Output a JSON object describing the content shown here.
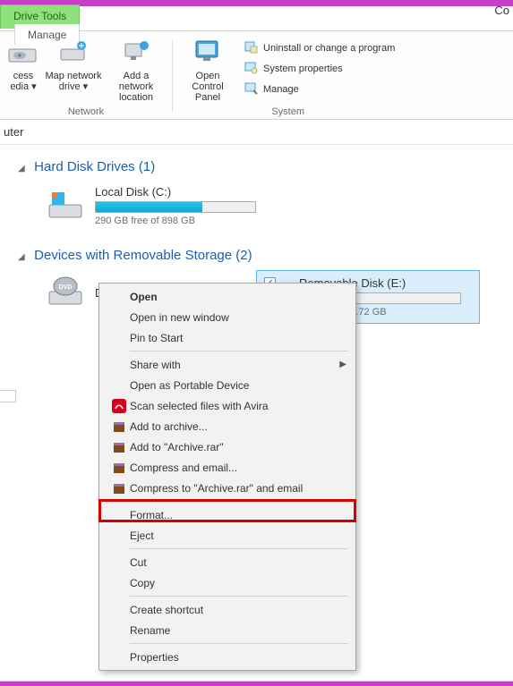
{
  "header": {
    "co": "Co"
  },
  "tabs": {
    "drive_tools": "Drive Tools",
    "manage": "Manage"
  },
  "ribbon": {
    "cess_media": "cess\nedia ▾",
    "map_network_drive": "Map network\ndrive ▾",
    "add_network_location": "Add a network\nlocation",
    "open_control_panel": "Open Control\nPanel",
    "network_group": "Network",
    "system_group": "System",
    "uninstall": "Uninstall or change a program",
    "sys_props": "System properties",
    "manage": "Manage"
  },
  "breadcrumb": "uter",
  "sections": {
    "hdd_title": "Hard Disk Drives",
    "hdd_count": "(1)",
    "dev_title": "Devices with Removable Storage",
    "dev_count": "(2)"
  },
  "drives": {
    "local": {
      "name": "Local Disk (C:)",
      "free": "290 GB free of 898 GB",
      "fill_pct": 67
    },
    "dvd": {
      "name": "DVD RW Drive (D:)"
    },
    "removable": {
      "name": "Removable Disk (E:)",
      "free": "free of 3.72 GB",
      "fill_pct": 5,
      "checked": "✓"
    }
  },
  "ctx": {
    "open": "Open",
    "open_new": "Open in new window",
    "pin": "Pin to Start",
    "share": "Share with",
    "portable": "Open as Portable Device",
    "avira": "Scan selected files with Avira",
    "add_archive": "Add to archive...",
    "add_archive_rar": "Add to \"Archive.rar\"",
    "compress_email": "Compress and email...",
    "compress_rar_email": "Compress to \"Archive.rar\" and email",
    "format": "Format...",
    "eject": "Eject",
    "cut": "Cut",
    "copy": "Copy",
    "shortcut": "Create shortcut",
    "rename": "Rename",
    "properties": "Properties"
  }
}
